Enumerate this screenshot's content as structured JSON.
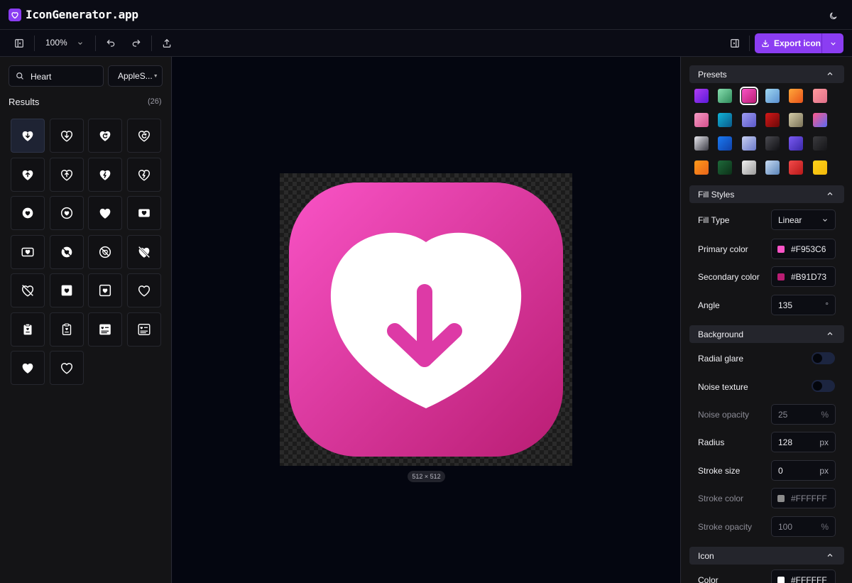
{
  "app": {
    "title": "IconGenerator.app"
  },
  "toolbar": {
    "zoom_value": "100%",
    "export_label": "Export icon"
  },
  "left": {
    "search": {
      "value": "Heart"
    },
    "library_value": "AppleS...",
    "results_label": "Results",
    "results_count": "(26)",
    "icons": [
      "heart-arrow-down-icon",
      "heart-arrow-down-outline-icon",
      "heart-refresh-icon",
      "heart-refresh-outline-icon",
      "heart-arrow-up-icon",
      "heart-arrow-up-outline-icon",
      "heart-bolt-icon",
      "heart-bolt-outline-icon",
      "heart-circle-icon",
      "heart-circle-outline-icon",
      "heart-filled-icon",
      "heart-rectangle-icon",
      "heart-rectangle-outline-icon",
      "heart-slash-circle-icon",
      "heart-slash-circle-outline-icon",
      "heart-slash-icon",
      "heart-slash-outline-icon",
      "heart-square-icon",
      "heart-square-outline-icon",
      "heart-outline-icon",
      "heart-clipboard-icon",
      "heart-clipboard-outline-icon",
      "heart-text-square-icon",
      "heart-text-square-outline-icon",
      "heart-fill-icon",
      "heart-stroke-icon"
    ]
  },
  "canvas": {
    "size_label": "512 × 512"
  },
  "right": {
    "presets": {
      "label": "Presets",
      "swatches": [
        [
          "#b03cf2",
          "#5b1ad9"
        ],
        [
          "#88e0b0",
          "#2e8a5a"
        ],
        [
          "#f953c6",
          "#b91d73"
        ],
        [
          "#9fd8f2",
          "#5a8fd0"
        ],
        [
          "#ffa83a",
          "#e8521a"
        ],
        [
          "#ff9a9e",
          "#e0708a"
        ],
        [
          "#f59bc4",
          "#d4508c"
        ],
        [
          "#11b4d8",
          "#0a5a8a"
        ],
        [
          "#9e9cf2",
          "#5a58c8"
        ],
        [
          "#d41818",
          "#6a0808"
        ],
        [
          "#d4cca8",
          "#7a7258"
        ],
        [
          "#ff5a8a",
          "#5a6af2"
        ],
        [
          "#e8e8ee",
          "#3a3a44"
        ],
        [
          "#1a7af2",
          "#1040a8"
        ],
        [
          "#c8d0f2",
          "#6a78c8"
        ],
        [
          "#4a4a50",
          "#101014"
        ],
        [
          "#7a5af2",
          "#3a28a8"
        ],
        [
          "#3a3a3e",
          "#151518"
        ],
        [
          "#ff9a1a",
          "#e8641a"
        ],
        [
          "#1e6a3a",
          "#0c3018"
        ],
        [
          "#f0f0f0",
          "#9a9a9a"
        ],
        [
          "#c8dcf4",
          "#5a84b8"
        ],
        [
          "#f24a4a",
          "#b81818"
        ],
        [
          "#ffd21a",
          "#f2b80a"
        ]
      ]
    },
    "fill": {
      "label": "Fill Styles",
      "fill_type_label": "Fill Type",
      "fill_type_value": "Linear",
      "primary_label": "Primary color",
      "primary_value": "#F953C6",
      "primary_color": "#F953C6",
      "secondary_label": "Secondary color",
      "secondary_value": "#B91D73",
      "secondary_color": "#B91D73",
      "angle_label": "Angle",
      "angle_value": "135",
      "angle_unit": "°"
    },
    "background": {
      "label": "Background",
      "radial_glare_label": "Radial glare",
      "radial_glare_on": false,
      "noise_label": "Noise texture",
      "noise_on": false,
      "noise_opacity_label": "Noise opacity",
      "noise_opacity_value": "25",
      "noise_opacity_unit": "%",
      "radius_label": "Radius",
      "radius_value": "128",
      "radius_unit": "px",
      "stroke_size_label": "Stroke size",
      "stroke_size_value": "0",
      "stroke_size_unit": "px",
      "stroke_color_label": "Stroke color",
      "stroke_color_value": "#FFFFFF",
      "stroke_opacity_label": "Stroke opacity",
      "stroke_opacity_value": "100",
      "stroke_opacity_unit": "%"
    },
    "icon": {
      "label": "Icon",
      "color_label": "Color",
      "color_value": "#FFFFFF",
      "color": "#FFFFFF"
    }
  },
  "colors": {
    "accent": "#8B3DF2",
    "panel": "#141416",
    "canvas": "#040610"
  }
}
